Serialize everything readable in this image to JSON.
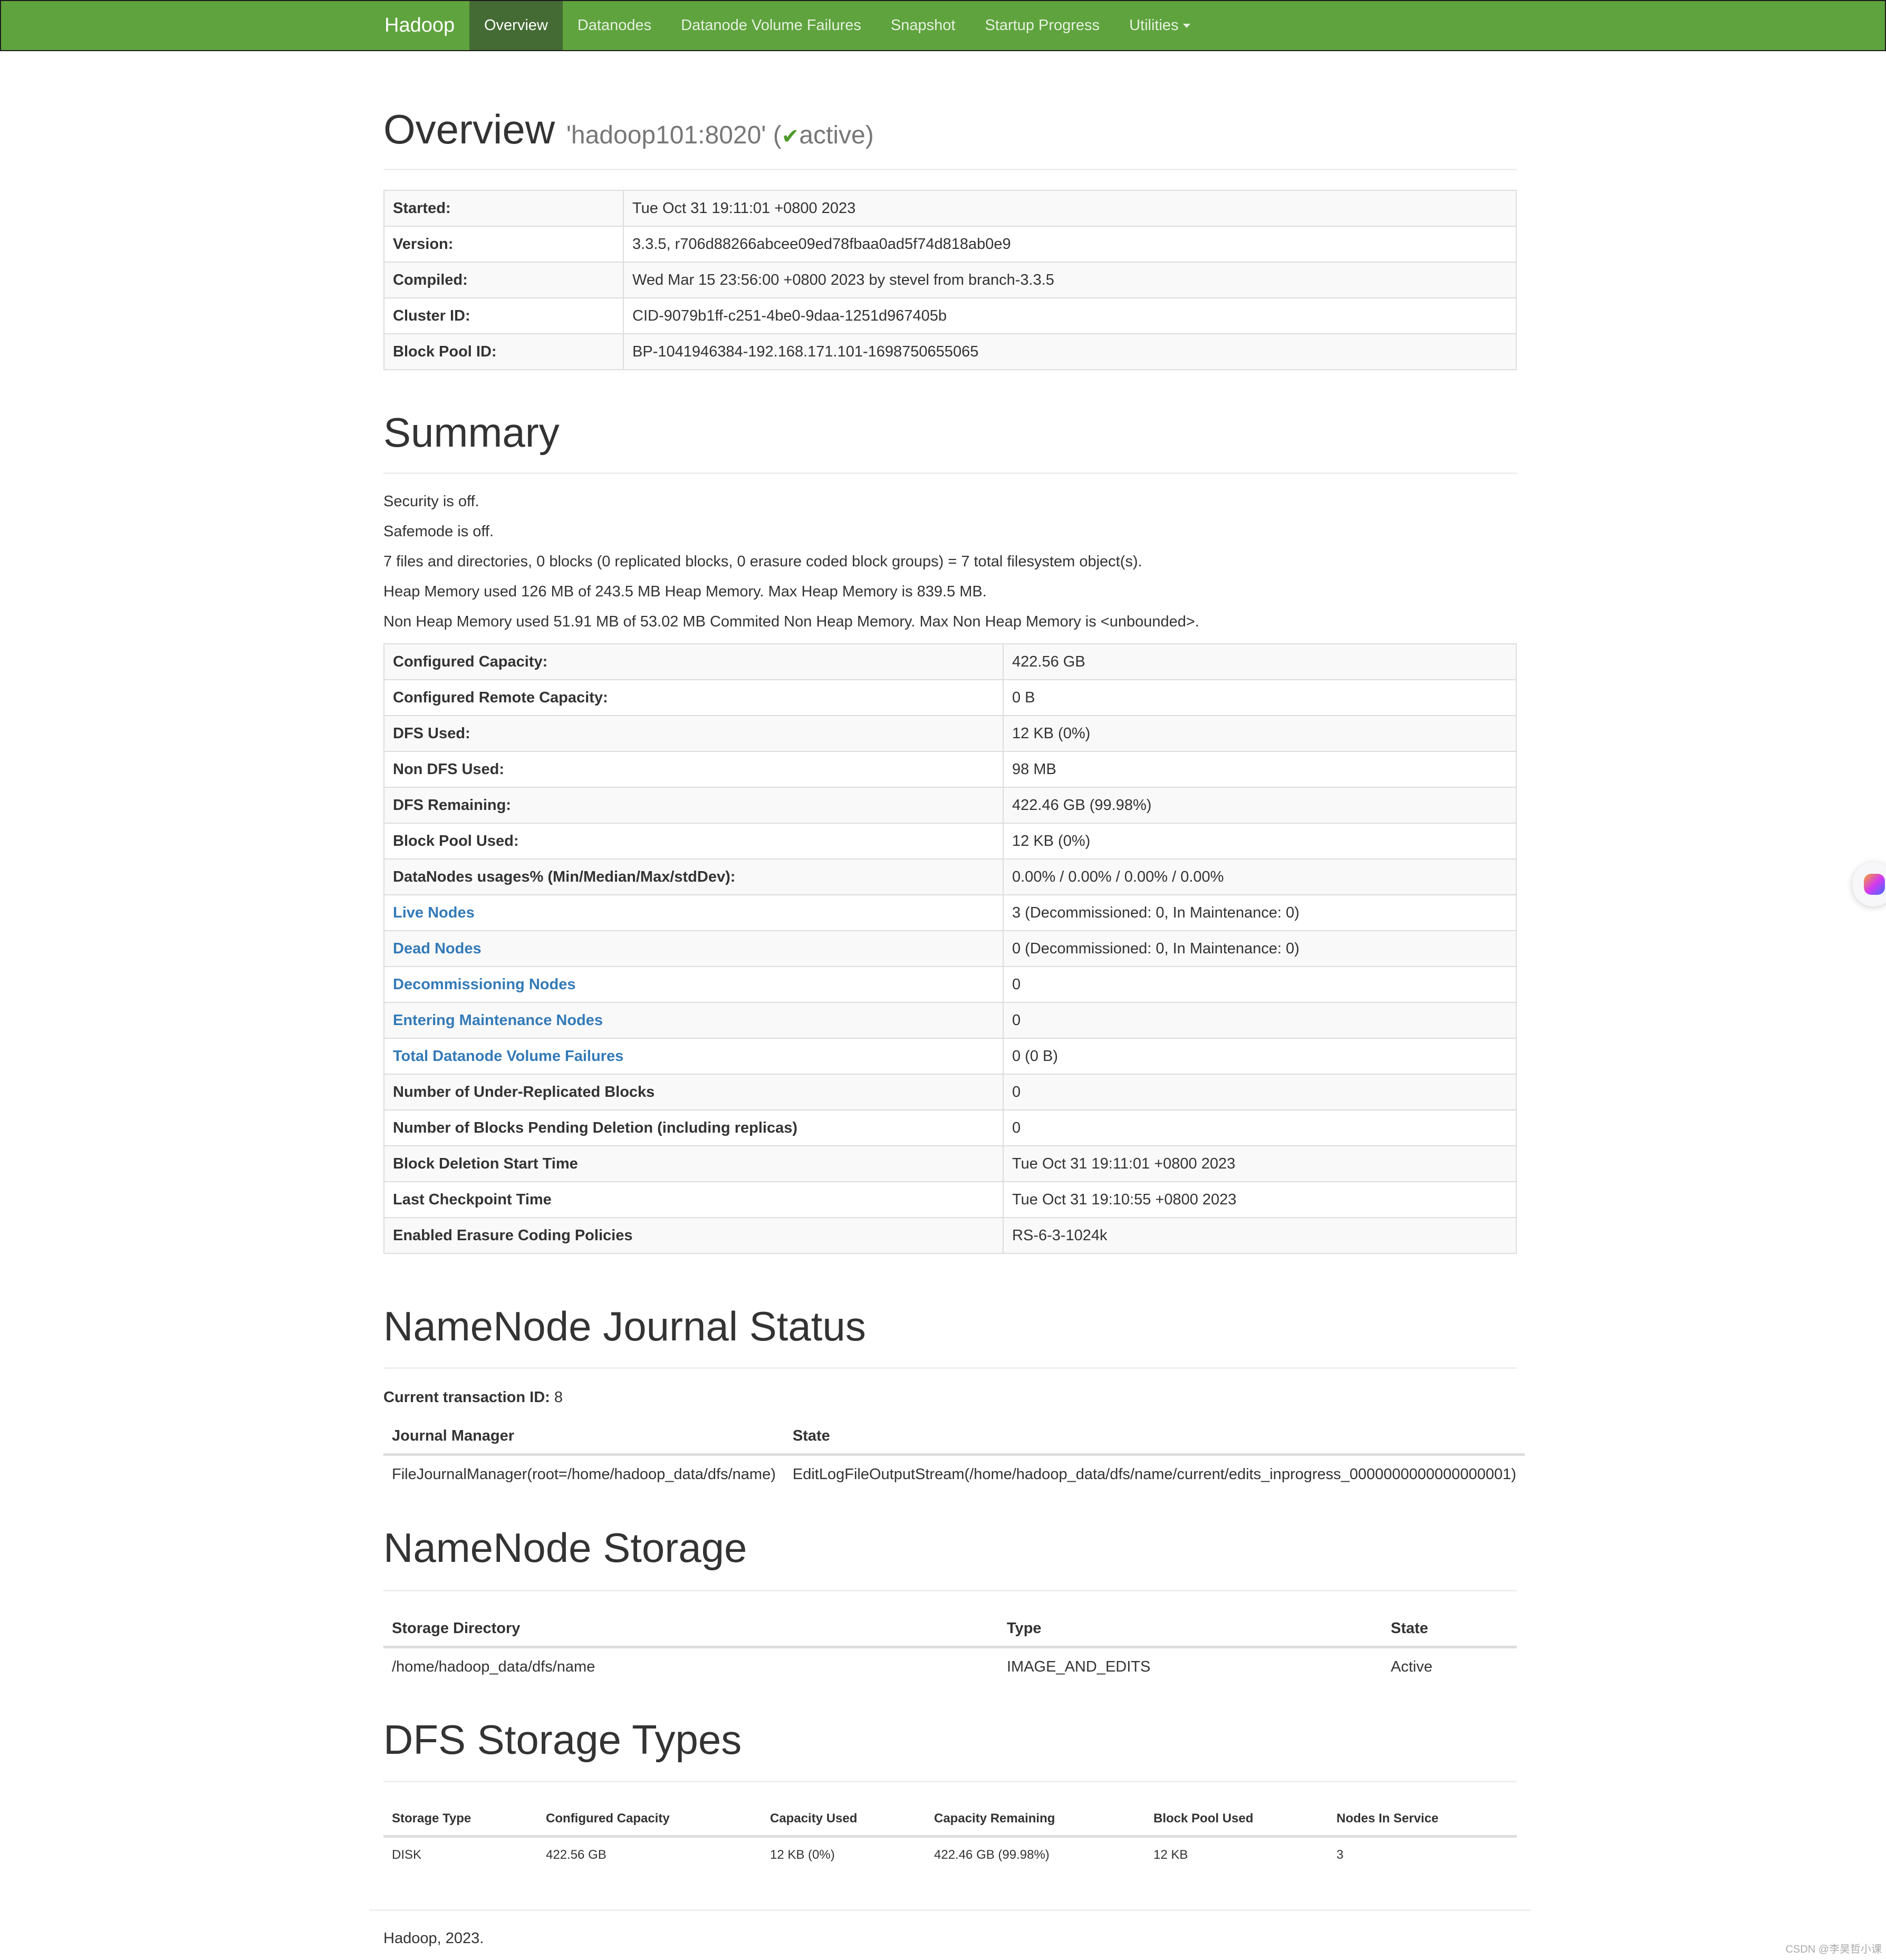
{
  "navbar": {
    "brand": "Hadoop",
    "items": [
      {
        "label": "Overview",
        "active": true
      },
      {
        "label": "Datanodes"
      },
      {
        "label": "Datanode Volume Failures"
      },
      {
        "label": "Snapshot"
      },
      {
        "label": "Startup Progress"
      },
      {
        "label": "Utilities"
      }
    ],
    "colors": {
      "bar": "#5fa33e",
      "active": "#446b34"
    }
  },
  "overview": {
    "title": "Overview",
    "host": "'hadoop101:8020'",
    "status_open": "(",
    "status_icon": "✔",
    "status": "active)",
    "rows": [
      {
        "label": "Started:",
        "value": "Tue Oct 31 19:11:01 +0800 2023"
      },
      {
        "label": "Version:",
        "value": "3.3.5, r706d88266abcee09ed78fbaa0ad5f74d818ab0e9"
      },
      {
        "label": "Compiled:",
        "value": "Wed Mar 15 23:56:00 +0800 2023 by stevel from branch-3.3.5"
      },
      {
        "label": "Cluster ID:",
        "value": "CID-9079b1ff-c251-4be0-9daa-1251d967405b"
      },
      {
        "label": "Block Pool ID:",
        "value": "BP-1041946384-192.168.171.101-1698750655065"
      }
    ]
  },
  "summary": {
    "title": "Summary",
    "lines": [
      "Security is off.",
      "Safemode is off.",
      "7 files and directories, 0 blocks (0 replicated blocks, 0 erasure coded block groups) = 7 total filesystem object(s).",
      "Heap Memory used 126 MB of 243.5 MB Heap Memory. Max Heap Memory is 839.5 MB.",
      "Non Heap Memory used 51.91 MB of 53.02 MB Commited Non Heap Memory. Max Non Heap Memory is <unbounded>."
    ],
    "rows": [
      {
        "label": "Configured Capacity:",
        "value": "422.56 GB"
      },
      {
        "label": "Configured Remote Capacity:",
        "value": "0 B"
      },
      {
        "label": "DFS Used:",
        "value": "12 KB (0%)"
      },
      {
        "label": "Non DFS Used:",
        "value": "98 MB"
      },
      {
        "label": "DFS Remaining:",
        "value": "422.46 GB (99.98%)"
      },
      {
        "label": "Block Pool Used:",
        "value": "12 KB (0%)"
      },
      {
        "label": "DataNodes usages% (Min/Median/Max/stdDev):",
        "value": "0.00% / 0.00% / 0.00% / 0.00%"
      },
      {
        "label": "Live Nodes",
        "value": "3 (Decommissioned: 0, In Maintenance: 0)",
        "link": true
      },
      {
        "label": "Dead Nodes",
        "value": "0 (Decommissioned: 0, In Maintenance: 0)",
        "link": true
      },
      {
        "label": "Decommissioning Nodes",
        "value": "0",
        "link": true
      },
      {
        "label": "Entering Maintenance Nodes",
        "value": "0",
        "link": true
      },
      {
        "label": "Total Datanode Volume Failures",
        "value": "0 (0 B)",
        "link": true
      },
      {
        "label": "Number of Under-Replicated Blocks",
        "value": "0"
      },
      {
        "label": "Number of Blocks Pending Deletion (including replicas)",
        "value": "0"
      },
      {
        "label": "Block Deletion Start Time",
        "value": "Tue Oct 31 19:11:01 +0800 2023"
      },
      {
        "label": "Last Checkpoint Time",
        "value": "Tue Oct 31 19:10:55 +0800 2023"
      },
      {
        "label": "Enabled Erasure Coding Policies",
        "value": "RS-6-3-1024k"
      }
    ]
  },
  "journal": {
    "title": "NameNode Journal Status",
    "txid_label": "Current transaction ID:",
    "txid": "8",
    "headers": [
      "Journal Manager",
      "State"
    ],
    "rows": [
      [
        "FileJournalManager(root=/home/hadoop_data/dfs/name)",
        "EditLogFileOutputStream(/home/hadoop_data/dfs/name/current/edits_inprogress_0000000000000000001)"
      ]
    ]
  },
  "storage": {
    "title": "NameNode Storage",
    "headers": [
      "Storage Directory",
      "Type",
      "State"
    ],
    "rows": [
      [
        "/home/hadoop_data/dfs/name",
        "IMAGE_AND_EDITS",
        "Active"
      ]
    ]
  },
  "dfs_types": {
    "title": "DFS Storage Types",
    "headers": [
      "Storage Type",
      "Configured Capacity",
      "Capacity Used",
      "Capacity Remaining",
      "Block Pool Used",
      "Nodes In Service"
    ],
    "rows": [
      [
        "DISK",
        "422.56 GB",
        "12 KB (0%)",
        "422.46 GB (99.98%)",
        "12 KB",
        "3"
      ]
    ]
  },
  "footer": {
    "text": "Hadoop, 2023."
  },
  "watermark": "CSDN @李昊哲小课"
}
